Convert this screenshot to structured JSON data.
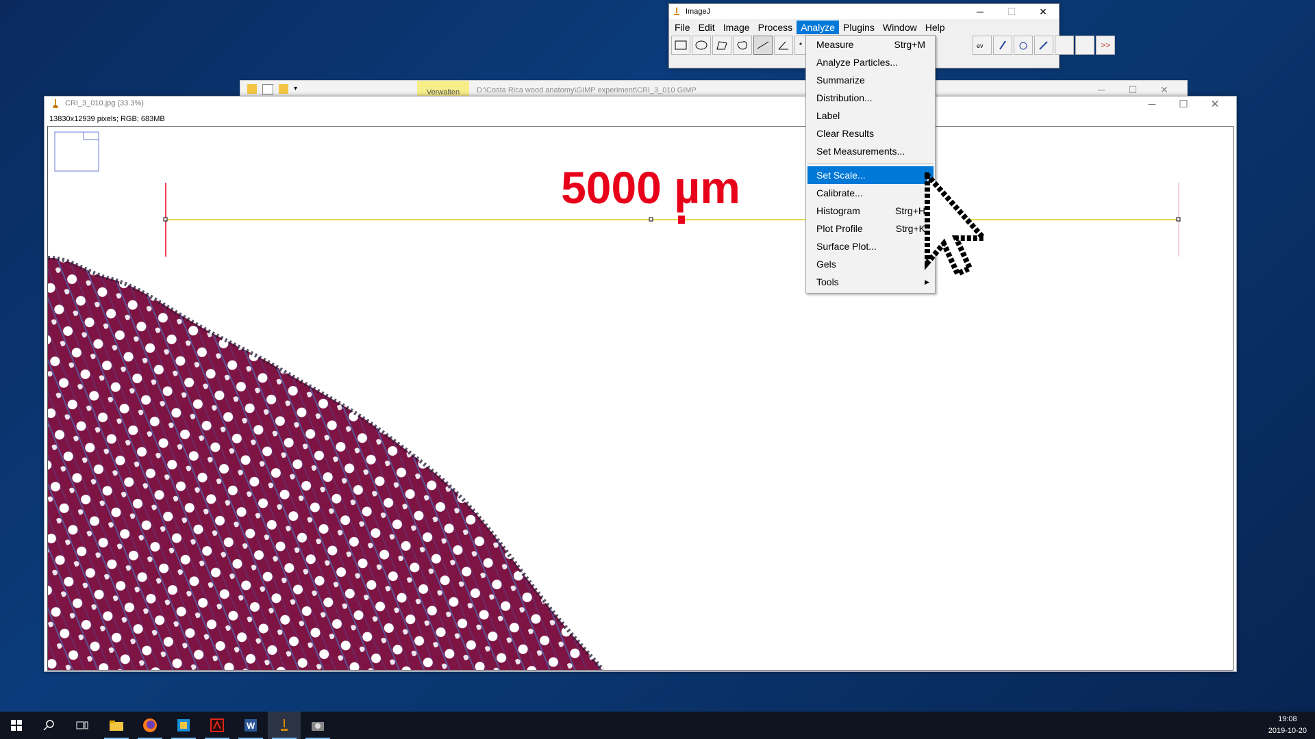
{
  "imagej": {
    "title": "ImageJ",
    "menus": [
      "File",
      "Edit",
      "Image",
      "Process",
      "Analyze",
      "Plugins",
      "Window",
      "Help"
    ],
    "active_menu": "Analyze",
    "toolbar_more": ">>"
  },
  "analyze_menu": {
    "items": [
      {
        "label": "Measure",
        "shortcut": "Strg+M"
      },
      {
        "label": "Analyze Particles..."
      },
      {
        "label": "Summarize"
      },
      {
        "label": "Distribution..."
      },
      {
        "label": "Label"
      },
      {
        "label": "Clear Results"
      },
      {
        "label": "Set Measurements..."
      },
      {
        "label": "Set Scale...",
        "highlighted": true
      },
      {
        "label": "Calibrate..."
      },
      {
        "label": "Histogram",
        "shortcut": "Strg+H"
      },
      {
        "label": "Plot Profile",
        "shortcut": "Strg+K"
      },
      {
        "label": "Surface Plot..."
      },
      {
        "label": "Gels"
      },
      {
        "label": "Tools"
      }
    ]
  },
  "explorer": {
    "manage_tab": "Verwalten",
    "path": "D:\\Costa Rica wood anatomy\\GIMP experiment\\CRI_3_010 GIMP"
  },
  "image_window": {
    "title": "CRI_3_010.jpg (33.3%)",
    "info": "13830x12939 pixels; RGB; 683MB",
    "scale_label": "5000 µm"
  },
  "taskbar": {
    "time": "19:08",
    "date": "2019-10-20"
  },
  "colors": {
    "highlight": "#0078d7",
    "scale_text": "#e8001a",
    "selection_line": "#e5d84a",
    "wood_primary": "#7a1242"
  }
}
